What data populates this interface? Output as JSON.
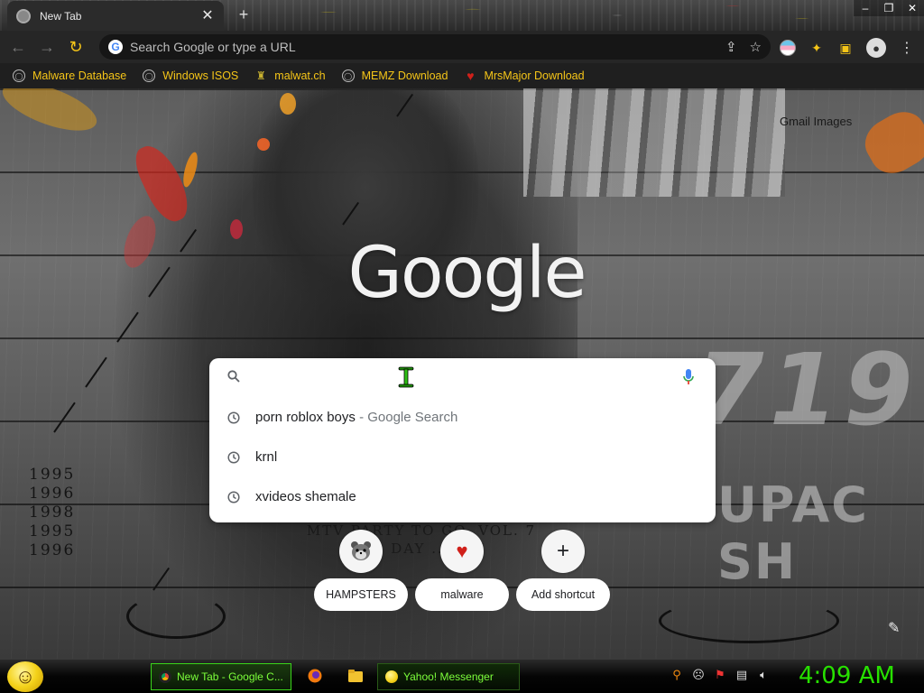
{
  "browser": {
    "tab": {
      "title": "New Tab",
      "close": "✕"
    },
    "new_tab": "+",
    "window_buttons": {
      "minimize": "–",
      "maximize": "❐",
      "close": "✕"
    },
    "omnibox": {
      "placeholder": "Search Google or type a URL"
    }
  },
  "bookmarks": [
    {
      "label": "Malware Database",
      "icon": "globe-icon"
    },
    {
      "label": "Windows ISOS",
      "icon": "globe-icon"
    },
    {
      "label": "malwat.ch",
      "icon": "bug-icon"
    },
    {
      "label": "MEMZ Download",
      "icon": "globe-icon"
    },
    {
      "label": "MrsMajor Download",
      "icon": "heart-icon"
    }
  ],
  "ntp": {
    "top_links": "Gmail  Images",
    "logo": "Google",
    "search": {
      "placeholder": ""
    },
    "suggestions": [
      {
        "query": "porn roblox boys",
        "suffix": " - Google Search"
      },
      {
        "query": "krnl",
        "suffix": ""
      },
      {
        "query": "xvideos shemale",
        "suffix": ""
      }
    ],
    "shortcuts": [
      {
        "label": "HAMPSTERS",
        "icon": "hamster-icon"
      },
      {
        "label": "malware",
        "icon": "heart-icon"
      },
      {
        "label": "Add shortcut",
        "icon": "plus-icon"
      }
    ],
    "wallpaper": {
      "years": [
        "1995",
        "1996",
        "1998",
        "1995",
        "1996"
      ],
      "album_line1": "MTV PARTY TO GO, VOL. 7",
      "album_line2": "T... DAY ...ORY",
      "big_text": "719",
      "side_text": "UPAC SH"
    }
  },
  "taskbar": {
    "tasks": [
      {
        "label": "New Tab - Google C...",
        "icon": "chrome-icon"
      },
      {
        "label": "Yahoo! Messenger",
        "icon": "yahoo-messenger-icon"
      }
    ],
    "clock": "4:09 AM"
  },
  "colors": {
    "bookmark_text": "#f5c518",
    "taskbar_text": "#7cff3a",
    "clock": "#27e000"
  }
}
